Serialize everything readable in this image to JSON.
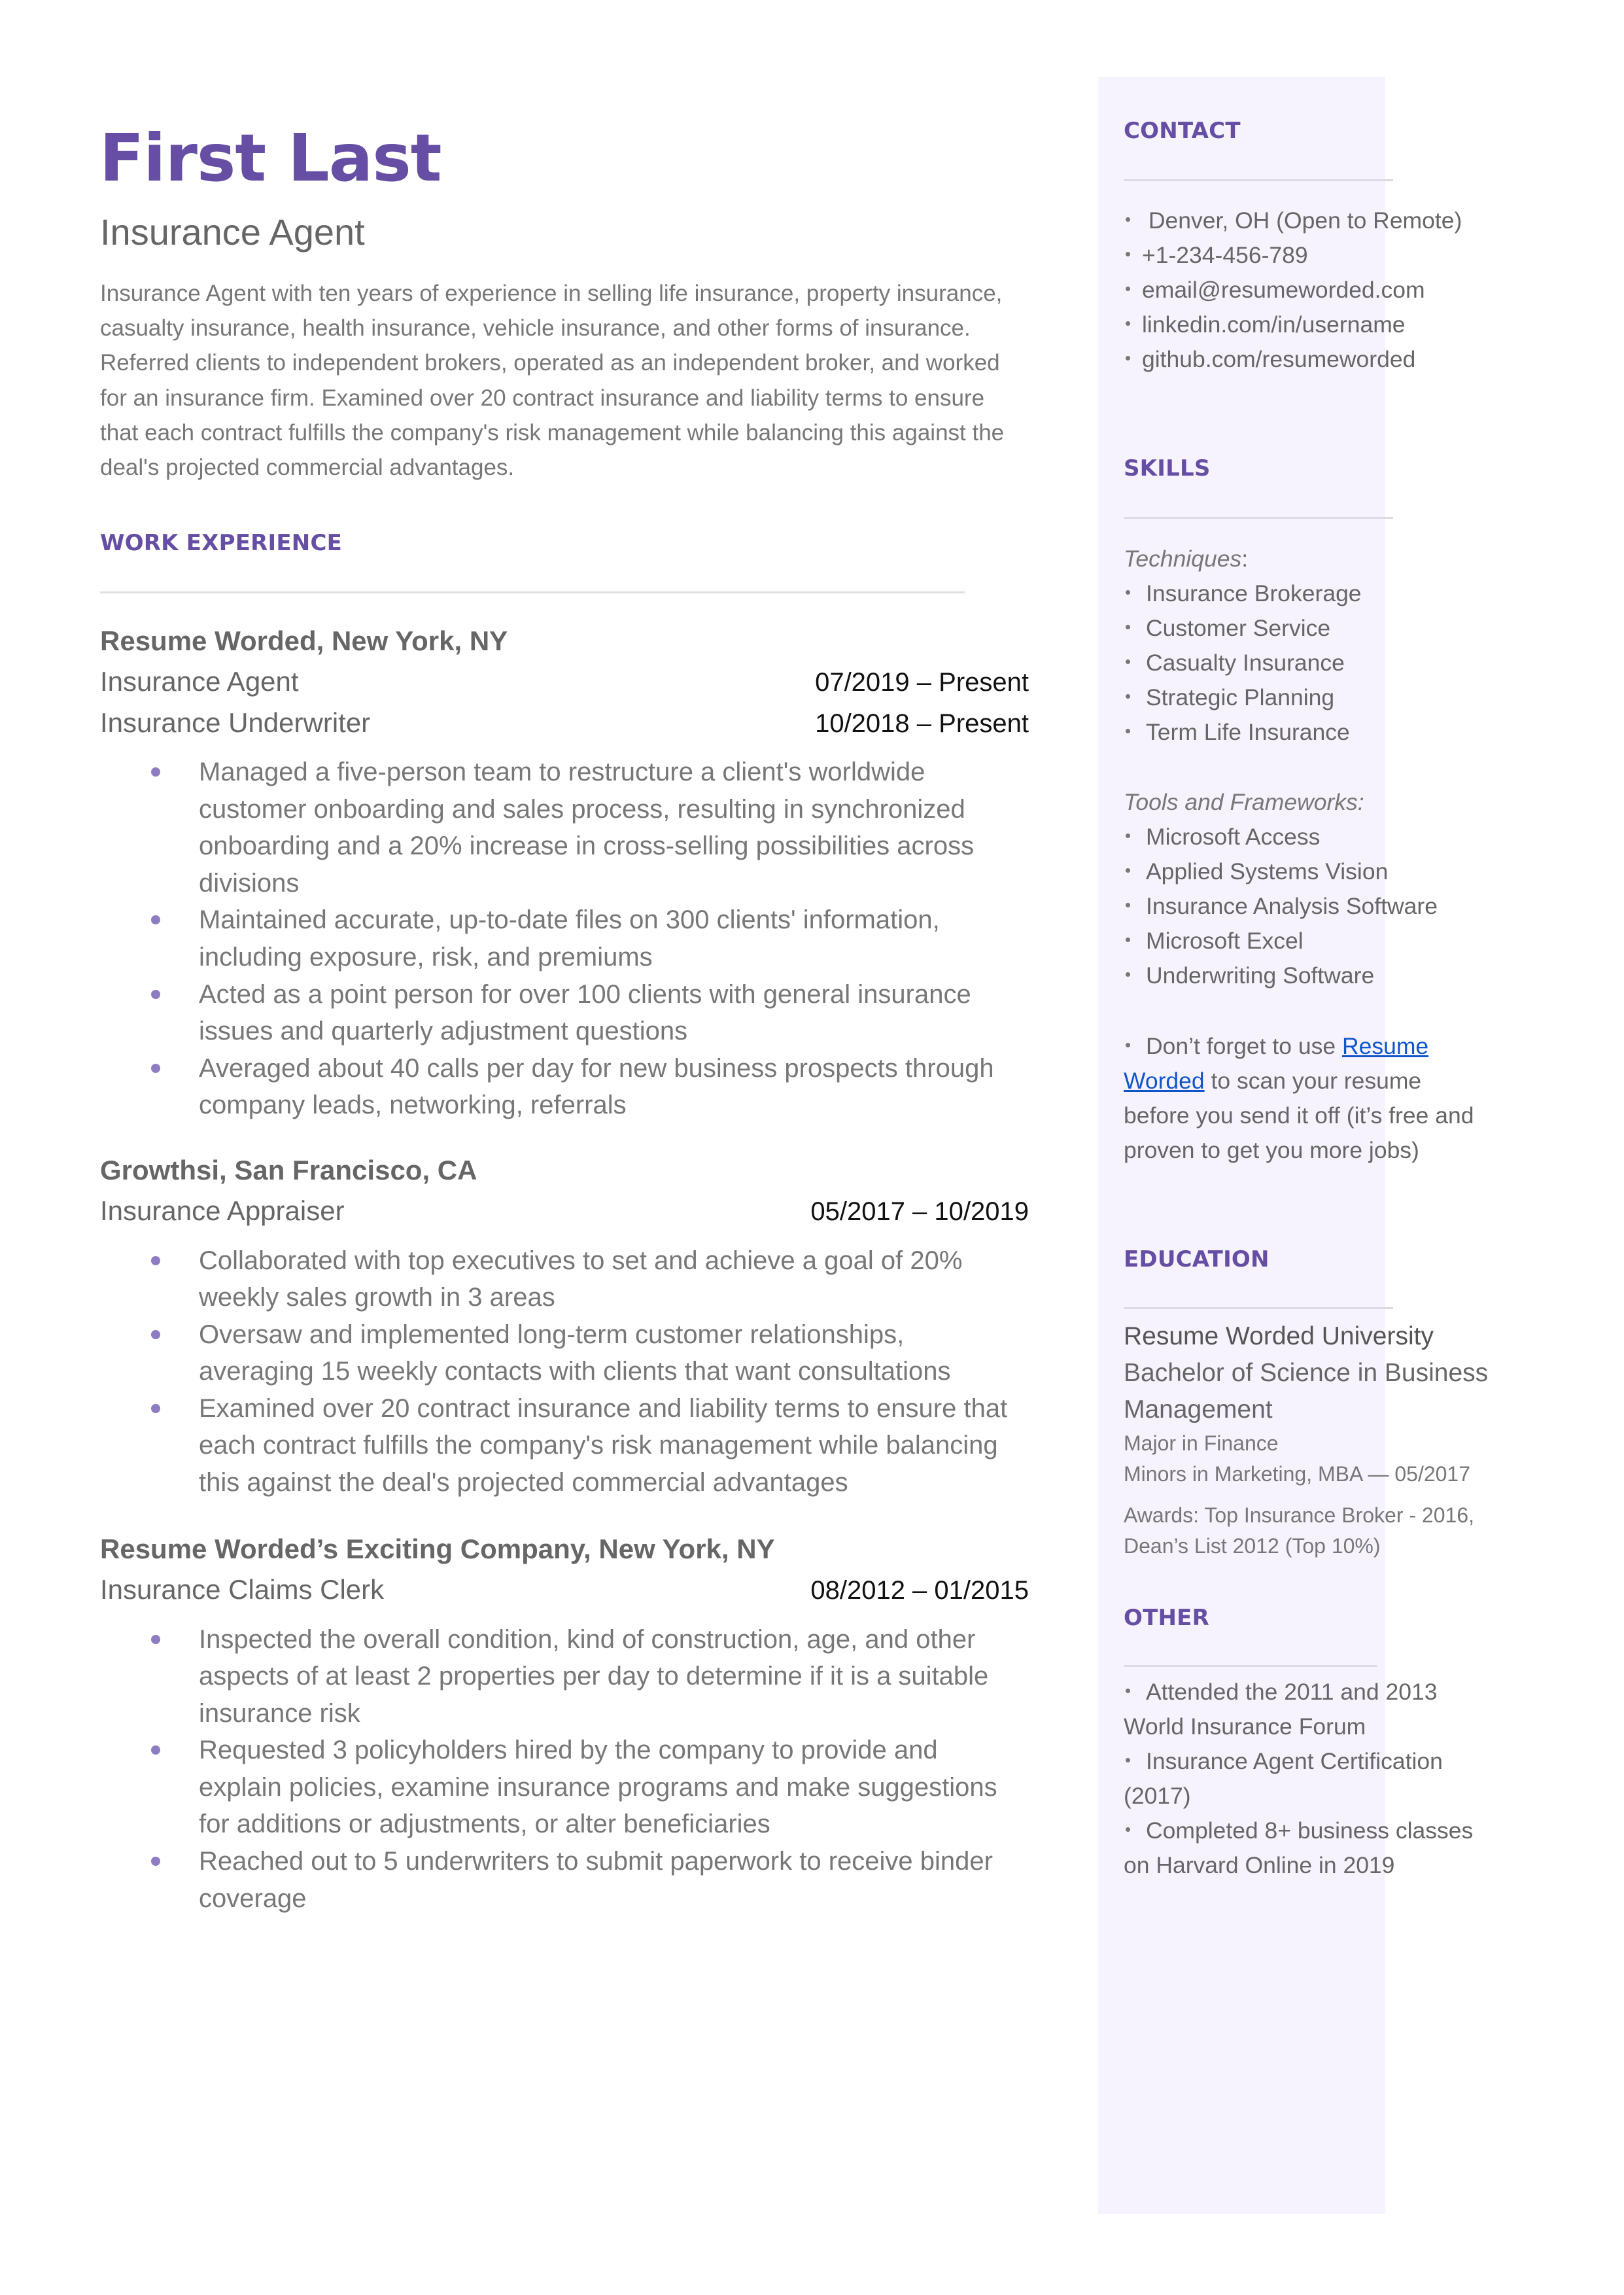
{
  "header": {
    "name": "First Last",
    "title": "Insurance Agent",
    "summary_lines": [
      "Insurance Agent with ten years of experience in selling life insurance, property insurance,",
      "casualty insurance, health insurance, vehicle insurance, and other forms of insurance.",
      "Referred clients to independent brokers, operated as an independent broker, and worked",
      "for an insurance firm. Examined over 20 contract insurance and liability terms to ensure",
      "that each contract fulfills the company's risk management while balancing this against the",
      "deal's projected commercial advantages."
    ]
  },
  "colors": {
    "accent": "#654EA3",
    "bullet": "#8E7CC3",
    "sidebar_bg": "#F6F3FE",
    "link": "#1155CC",
    "text": "#666666"
  },
  "work_experience": {
    "title": "WORK EXPERIENCE",
    "jobs": [
      {
        "company": "Resume Worded, New York, NY",
        "roles": [
          {
            "title": "Insurance Agent",
            "dates": "07/2019 – Present"
          },
          {
            "title": "Insurance Underwriter",
            "dates": "10/2018 – Present"
          }
        ],
        "bullets": [
          [
            "Managed a five-person team to restructure a client's worldwide",
            "customer onboarding and sales process, resulting in synchronized",
            "onboarding and a 20% increase in cross-selling possibilities across",
            "divisions"
          ],
          [
            "Maintained accurate, up-to-date files on 300 clients' information,",
            "including exposure, risk, and premiums"
          ],
          [
            "Acted as a point person for over 100 clients with general insurance",
            "issues and quarterly adjustment questions"
          ],
          [
            "Averaged about 40 calls per day for new business prospects through",
            "company leads, networking, referrals"
          ]
        ]
      },
      {
        "company": "Growthsi, San Francisco, CA",
        "roles": [
          {
            "title": "Insurance Appraiser",
            "dates": "05/2017 – 10/2019"
          }
        ],
        "bullets": [
          [
            "Collaborated with top executives to set and achieve a goal of 20%",
            "weekly sales growth in 3 areas"
          ],
          [
            "Oversaw and implemented long-term customer relationships,",
            "averaging 15 weekly contacts with clients that want consultations"
          ],
          [
            "Examined over 20 contract insurance and liability terms to ensure that",
            "each contract fulfills the company's risk management while balancing",
            "this against the deal's projected commercial advantages"
          ]
        ]
      },
      {
        "company": "Resume Worded’s Exciting Company, New York, NY",
        "roles": [
          {
            "title": "Insurance Claims Clerk",
            "dates": "08/2012 – 01/2015"
          }
        ],
        "bullets": [
          [
            "Inspected the overall condition, kind of construction, age, and other",
            "aspects of at least 2 properties per day to determine if it is a suitable",
            "insurance risk"
          ],
          [
            "Requested 3 policyholders hired by the company to provide and",
            "explain policies, examine insurance programs and make suggestions",
            "for additions or adjustments, or alter beneficiaries"
          ],
          [
            "Reached out to 5 underwriters to submit paperwork to receive binder",
            "coverage"
          ]
        ]
      }
    ]
  },
  "sidebar": {
    "contact": {
      "title": "CONTACT",
      "items": [
        " Denver, OH (Open to Remote)",
        "+1-234-456-789",
        "email@resumeworded.com",
        "linkedin.com/in/username",
        "github.com/resumeworded"
      ]
    },
    "skills": {
      "title": "SKILLS",
      "techniques_label": "Techniques",
      "techniques_colon": ":",
      "techniques": [
        "Insurance Brokerage",
        "Customer Service",
        "Casualty Insurance",
        "Strategic Planning",
        "Term Life Insurance"
      ],
      "tools_label": "Tools and Frameworks:",
      "tools": [
        "Microsoft Access",
        "Applied Systems Vision",
        "Insurance Analysis Software",
        "Microsoft Excel",
        "Underwriting Software"
      ],
      "tip": {
        "prefix": "Don’t forget to use ",
        "link_line1": "Resume",
        "link_line2": "Worded",
        "line2_rest": " to scan your resume",
        "line3": "before you send it off (it’s free and",
        "line4": "proven to get you more jobs)"
      }
    },
    "education": {
      "title": "EDUCATION",
      "school": "Resume Worded University",
      "degree_line1": "Bachelor of Science in Business",
      "degree_line2": "Management",
      "major": "Major in Finance",
      "minors": "Minors in Marketing, MBA — 05/2017",
      "awards_line1": "Awards: Top Insurance Broker - 2016,",
      "awards_line2": "Dean’s List 2012 (Top 10%)"
    },
    "other": {
      "title": "OTHER",
      "items": [
        [
          "Attended the 2011 and 2013",
          "World Insurance Forum"
        ],
        [
          "Insurance Agent Certification",
          "(2017)"
        ],
        [
          "Completed 8+ business classes",
          "on Harvard Online in 2019"
        ]
      ]
    }
  }
}
